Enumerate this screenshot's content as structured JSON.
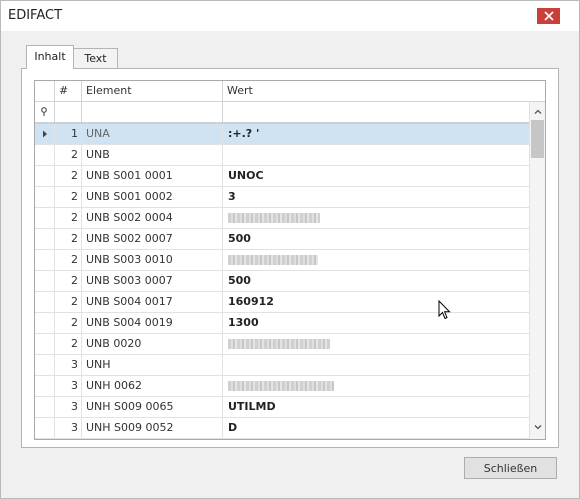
{
  "window": {
    "title": "EDIFACT",
    "close_label": "✕"
  },
  "tabs": [
    {
      "label": "Inhalt",
      "active": true
    },
    {
      "label": "Text",
      "active": false
    }
  ],
  "grid": {
    "columns": {
      "num": "#",
      "element": "Element",
      "value": "Wert"
    },
    "rows": [
      {
        "num": "1",
        "element": "UNA",
        "value": ":+.? '",
        "selected": true,
        "redacted": false
      },
      {
        "num": "2",
        "element": "UNB",
        "value": "",
        "redacted": false
      },
      {
        "num": "2",
        "element": "UNB S001 0001",
        "value": "UNOC",
        "redacted": false
      },
      {
        "num": "2",
        "element": "UNB S001 0002",
        "value": "3",
        "redacted": false
      },
      {
        "num": "2",
        "element": "UNB S002 0004",
        "value": "",
        "redacted": true,
        "redact_len": 92
      },
      {
        "num": "2",
        "element": "UNB S002 0007",
        "value": "500",
        "redacted": false
      },
      {
        "num": "2",
        "element": "UNB S003 0010",
        "value": "",
        "redacted": true,
        "redact_len": 90
      },
      {
        "num": "2",
        "element": "UNB S003 0007",
        "value": "500",
        "redacted": false
      },
      {
        "num": "2",
        "element": "UNB S004 0017",
        "value": "160912",
        "redacted": false
      },
      {
        "num": "2",
        "element": "UNB S004 0019",
        "value": "1300",
        "redacted": false
      },
      {
        "num": "2",
        "element": "UNB 0020",
        "value": "",
        "redacted": true,
        "redact_len": 102
      },
      {
        "num": "3",
        "element": "UNH",
        "value": "",
        "redacted": false
      },
      {
        "num": "3",
        "element": "UNH 0062",
        "value": "",
        "redacted": true,
        "redact_len": 106
      },
      {
        "num": "3",
        "element": "UNH S009 0065",
        "value": "UTILMD",
        "redacted": false
      },
      {
        "num": "3",
        "element": "UNH S009 0052",
        "value": "D",
        "redacted": false
      }
    ]
  },
  "footer": {
    "close_button_label": "Schließen"
  },
  "icons": {
    "filter": "pin-icon",
    "row_indicator": "triangle-right-icon",
    "scroll_up": "chevron-up-icon",
    "scroll_down": "chevron-down-icon"
  }
}
